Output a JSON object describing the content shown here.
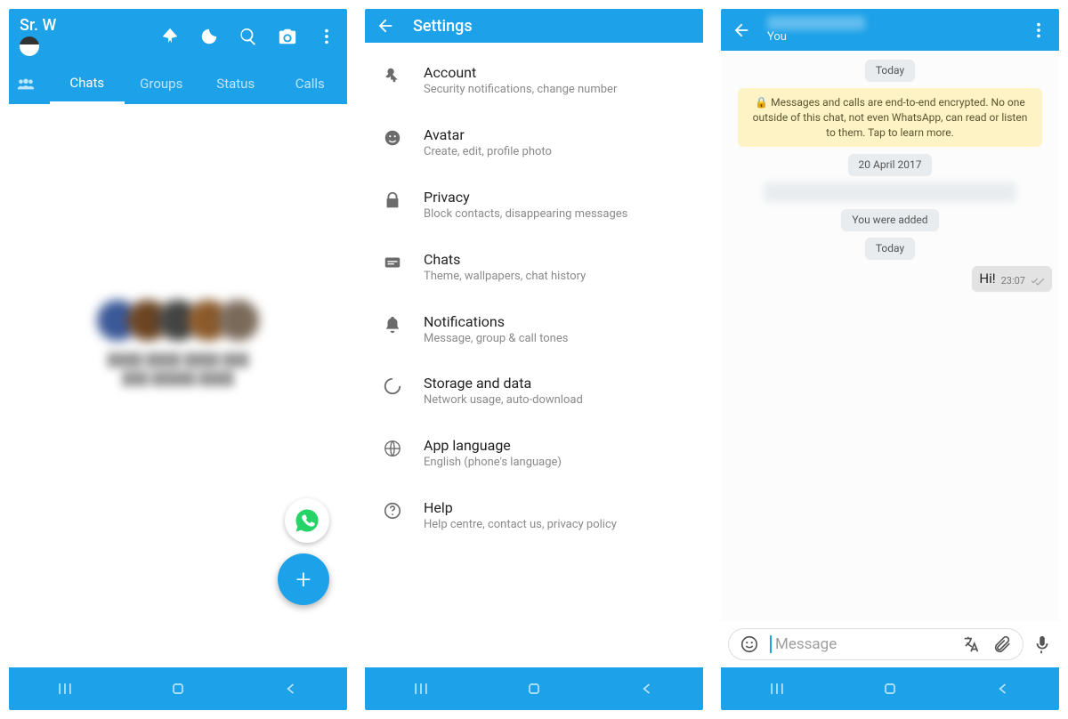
{
  "accent": "#1DA1E8",
  "screen1": {
    "user": "Sr. W",
    "tabs": [
      "Chats",
      "Groups",
      "Status",
      "Calls"
    ],
    "active_tab": 0
  },
  "screen2": {
    "title": "Settings",
    "items": [
      {
        "title": "Account",
        "desc": "Security notifications, change number"
      },
      {
        "title": "Avatar",
        "desc": "Create, edit, profile photo"
      },
      {
        "title": "Privacy",
        "desc": "Block contacts, disappearing messages"
      },
      {
        "title": "Chats",
        "desc": "Theme, wallpapers, chat history"
      },
      {
        "title": "Notifications",
        "desc": "Message, group & call tones"
      },
      {
        "title": "Storage and data",
        "desc": "Network usage, auto-download"
      },
      {
        "title": "App language",
        "desc": "English (phone's language)"
      },
      {
        "title": "Help",
        "desc": "Help centre, contact us, privacy policy"
      }
    ]
  },
  "screen3": {
    "subtitle": "You",
    "chips": {
      "today": "Today",
      "date": "20 April 2017",
      "added": "You were added"
    },
    "notice": "🔒 Messages and calls are end-to-end encrypted. No one outside of this chat, not even WhatsApp, can read or listen to them. Tap to learn more.",
    "msg": {
      "text": "Hi!",
      "time": "23:07"
    },
    "input_placeholder": "Message"
  }
}
